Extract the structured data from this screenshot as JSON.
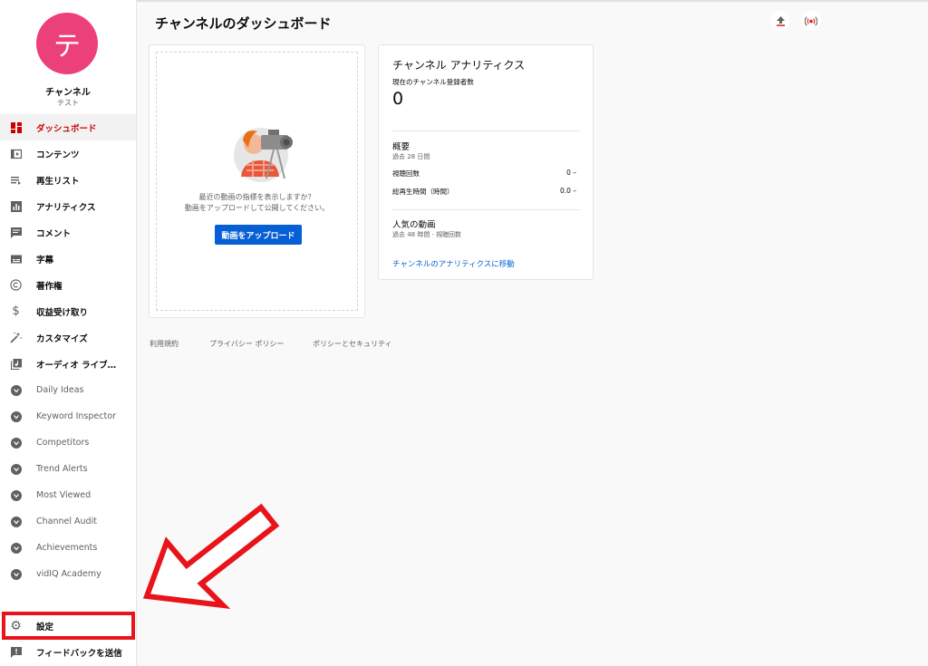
{
  "channel": {
    "avatar_letter": "テ",
    "name": "チャンネル",
    "subtitle": "テスト"
  },
  "nav": {
    "items": [
      {
        "label": "ダッシュボード",
        "icon": "dashboard-icon"
      },
      {
        "label": "コンテンツ",
        "icon": "content-icon"
      },
      {
        "label": "再生リスト",
        "icon": "playlist-icon"
      },
      {
        "label": "アナリティクス",
        "icon": "analytics-icon"
      },
      {
        "label": "コメント",
        "icon": "comment-icon"
      },
      {
        "label": "字幕",
        "icon": "subtitles-icon"
      },
      {
        "label": "著作権",
        "icon": "copyright-icon"
      },
      {
        "label": "収益受け取り",
        "icon": "dollar-icon"
      },
      {
        "label": "カスタマイズ",
        "icon": "magic-wand-icon"
      },
      {
        "label": "オーディオ ライブ…",
        "icon": "audio-library-icon"
      }
    ],
    "extensions": [
      "Daily Ideas",
      "Keyword Inspector",
      "Competitors",
      "Trend Alerts",
      "Most Viewed",
      "Channel Audit",
      "Achievements",
      "vidIQ Academy"
    ],
    "settings_label": "設定",
    "feedback_label": "フィードバックを送信"
  },
  "header": {
    "title": "チャンネルのダッシュボード"
  },
  "upload_card": {
    "message_line1": "最近の動画の指標を表示しますか？",
    "message_line2": "動画をアップロードして公開してください。",
    "button_label": "動画をアップロード"
  },
  "analytics": {
    "title": "チャンネル アナリティクス",
    "subscribers_label": "現在のチャンネル登録者数",
    "subscribers_value": "0",
    "summary_title": "概要",
    "summary_period": "過去 28 日間",
    "views_label": "視聴回数",
    "views_value": "0 –",
    "watch_time_label": "総再生時間（時間）",
    "watch_time_value": "0.0 –",
    "popular_title": "人気の動画",
    "popular_period": "過去 48 時間 · 視聴回数",
    "link_label": "チャンネルのアナリティクスに移動"
  },
  "footer": {
    "terms": "利用規約",
    "privacy": "プライバシー ポリシー",
    "safety": "ポリシーとセキュリティ"
  },
  "colors": {
    "accent_red": "#cc0000",
    "annotation_red": "#e8141a",
    "link_blue": "#065fd4",
    "avatar_pink": "#ec407a"
  }
}
